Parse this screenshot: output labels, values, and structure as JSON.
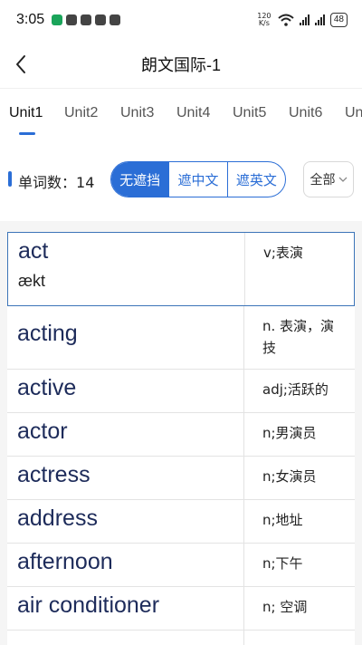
{
  "status_bar": {
    "time": "3:05",
    "net_speed_top": "120",
    "net_speed_bottom": "K/s",
    "battery": "48"
  },
  "header": {
    "back_icon": "chevron-left-icon",
    "title": "朗文国际-1"
  },
  "tabs": [
    {
      "label": "Unit1",
      "active": true
    },
    {
      "label": "Unit2"
    },
    {
      "label": "Unit3"
    },
    {
      "label": "Unit4"
    },
    {
      "label": "Unit5"
    },
    {
      "label": "Unit6"
    },
    {
      "label": "Un"
    }
  ],
  "toolbar": {
    "word_count_label": "单词数：",
    "word_count": "14",
    "modes": [
      {
        "label": "无遮挡",
        "active": true
      },
      {
        "label": "遮中文"
      },
      {
        "label": "遮英文"
      }
    ],
    "filter_label": "全部",
    "filter_icon": "chevron-down-icon"
  },
  "colors": {
    "accent": "#2b6ed6",
    "word_text": "#1d2b5a",
    "list_background": "#f5f5f5"
  },
  "words": [
    {
      "en": "act",
      "phonetic": "ækt",
      "cn": "v;表演"
    },
    {
      "en": "acting",
      "cn": "n. 表演，演技"
    },
    {
      "en": "active",
      "cn": "adj;活跃的"
    },
    {
      "en": "actor",
      "cn": "n;男演员"
    },
    {
      "en": "actress",
      "cn": "n;女演员"
    },
    {
      "en": "address",
      "cn": "n;地址"
    },
    {
      "en": "afternoon",
      "cn": "n;下午"
    },
    {
      "en": "air conditioner",
      "cn": "n; 空调"
    },
    {
      "en": "",
      "cn": ""
    }
  ]
}
